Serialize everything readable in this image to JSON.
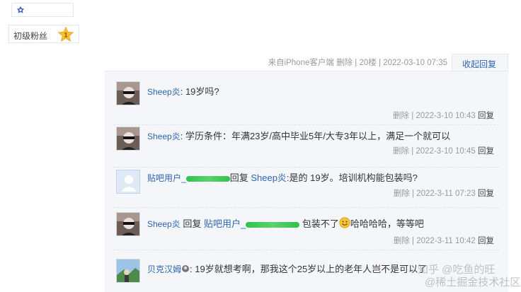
{
  "sidebar": {
    "fan_level_label": "初级粉丝",
    "fan_level_number": "1"
  },
  "post_meta": {
    "source": "来自iPhone客户端",
    "delete": "删除",
    "floor": "20楼",
    "timestamp": "2022-03-10 07:35",
    "collapse_label": "收起回复"
  },
  "replies": [
    {
      "author": "Sheep炎",
      "text": "19岁吗?",
      "delete": "删除",
      "time": "2022-3-10 10:43",
      "reply": "回复"
    },
    {
      "author": "Sheep炎",
      "text": "学历条件：年满23岁/高中毕业5年/大专3年以上，满足一个就可以",
      "delete": "删除",
      "time": "2022-3-10 10:45",
      "reply": "回复"
    },
    {
      "author": "贴吧用户_",
      "reply_word": "回复",
      "target": "Sheep炎",
      "text": ":是的 19岁。培训机构能包装吗?",
      "delete": "删除",
      "time": "2022-3-11 07:23",
      "reply": "回复"
    },
    {
      "author": "Sheep炎",
      "reply_word": "回复",
      "target": "贴吧用户_",
      "text_before": "包装不了",
      "text_after": "哈哈哈哈，等等吧",
      "delete": "删除",
      "time": "2022-3-11 10:42",
      "reply": "回复"
    },
    {
      "author": "贝克汉姆",
      "text": "19岁就想考啊，那我这个25岁以上的老年人岂不是可以了"
    }
  ],
  "watermark": {
    "line1": "知乎 @吃鱼的旺",
    "line2": "@稀土掘金技术社区"
  },
  "colors": {
    "link_blue": "#2d64b3",
    "panel_bg": "#f4f6f9",
    "meta_gray": "#999999",
    "scribble_green": "#2fc34c"
  }
}
